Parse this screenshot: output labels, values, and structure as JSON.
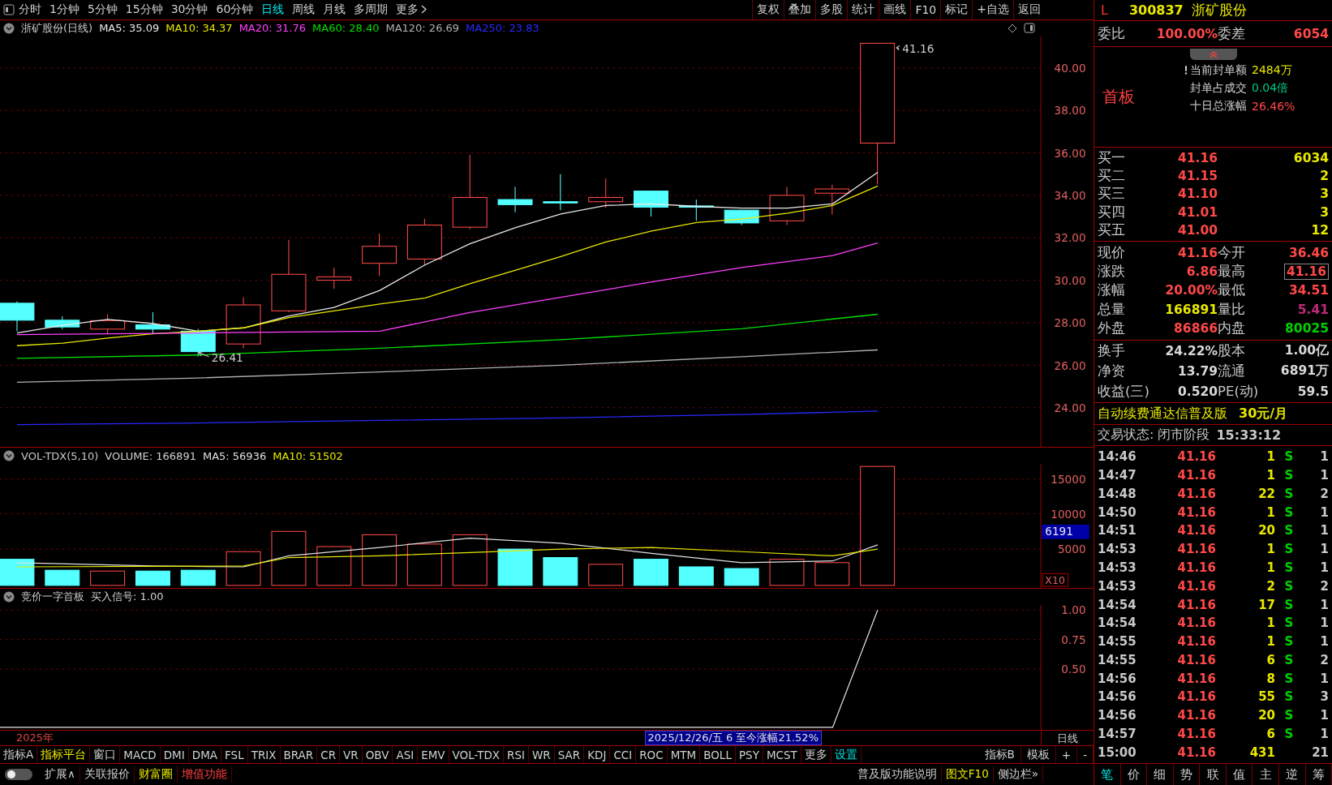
{
  "toolbar": {
    "periods": [
      {
        "label": "分时",
        "selected": false
      },
      {
        "label": "1分钟",
        "selected": false
      },
      {
        "label": "5分钟",
        "selected": false
      },
      {
        "label": "15分钟",
        "selected": false
      },
      {
        "label": "30分钟",
        "selected": false
      },
      {
        "label": "60分钟",
        "selected": false
      },
      {
        "label": "日线",
        "selected": true
      },
      {
        "label": "周线",
        "selected": false
      },
      {
        "label": "月线",
        "selected": false
      },
      {
        "label": "多周期",
        "selected": false
      }
    ],
    "more": "更多",
    "actions": [
      "复权",
      "叠加",
      "多股",
      "统计",
      "画线",
      "F10",
      "标记",
      "+自选",
      "返回"
    ]
  },
  "price_pane": {
    "title": "浙矿股份(日线)",
    "indicators": [
      {
        "label": "MA5: 35.09",
        "color": "#e8e8e8"
      },
      {
        "label": "MA10: 34.37",
        "color": "#e8e800"
      },
      {
        "label": "MA20: 31.76",
        "color": "#ff40ff"
      },
      {
        "label": "MA60: 28.40",
        "color": "#00e000"
      },
      {
        "label": "MA120: 26.69",
        "color": "#b0b0b0"
      },
      {
        "label": "MA250: 23.83",
        "color": "#2828ff"
      }
    ],
    "y_labels": [
      "40.00",
      "38.00",
      "36.00",
      "34.00",
      "32.00",
      "30.00",
      "28.00",
      "26.00",
      "24.00"
    ],
    "high_label": "41.16",
    "low_label": "26.41"
  },
  "volume_pane": {
    "title": "VOL-TDX(5,10)",
    "indicators": [
      {
        "label": "VOLUME: 166891",
        "color": "#d0d0d0"
      },
      {
        "label": "MA5: 56936",
        "color": "#e0e0e0"
      },
      {
        "label": "MA10: 51502",
        "color": "#e8e800"
      }
    ],
    "y_labels": [
      "15000",
      "10000",
      "5000"
    ],
    "cursor_value": "6191",
    "scale": "X10"
  },
  "signal_pane": {
    "title": "竞价一字首板",
    "indicators": [
      {
        "label": "买入信号: 1.00",
        "color": "#d0d0d0"
      }
    ],
    "y_labels": [
      "1.00",
      "0.75",
      "0.50"
    ]
  },
  "date_bar": {
    "year": "2025年",
    "info": "2025/12/26/五 6 至今涨幅21.52%",
    "period": "日线"
  },
  "indicator_tabs": [
    {
      "label": "指标A",
      "color": "#d0d0d0"
    },
    {
      "label": "指标平台",
      "color": "#e8e800"
    },
    {
      "label": "窗口",
      "color": "#d0d0d0"
    },
    {
      "label": "MACD",
      "color": "#d0d0d0"
    },
    {
      "label": "DMI",
      "color": "#d0d0d0"
    },
    {
      "label": "DMA",
      "color": "#d0d0d0"
    },
    {
      "label": "FSL",
      "color": "#d0d0d0"
    },
    {
      "label": "TRIX",
      "color": "#d0d0d0"
    },
    {
      "label": "BRAR",
      "color": "#d0d0d0"
    },
    {
      "label": "CR",
      "color": "#d0d0d0"
    },
    {
      "label": "VR",
      "color": "#d0d0d0"
    },
    {
      "label": "OBV",
      "color": "#d0d0d0"
    },
    {
      "label": "ASI",
      "color": "#d0d0d0"
    },
    {
      "label": "EMV",
      "color": "#d0d0d0"
    },
    {
      "label": "VOL-TDX",
      "color": "#d0d0d0"
    },
    {
      "label": "RSI",
      "color": "#d0d0d0"
    },
    {
      "label": "WR",
      "color": "#d0d0d0"
    },
    {
      "label": "SAR",
      "color": "#d0d0d0"
    },
    {
      "label": "KDJ",
      "color": "#d0d0d0"
    },
    {
      "label": "CCI",
      "color": "#d0d0d0"
    },
    {
      "label": "ROC",
      "color": "#d0d0d0"
    },
    {
      "label": "MTM",
      "color": "#d0d0d0"
    },
    {
      "label": "BOLL",
      "color": "#d0d0d0"
    },
    {
      "label": "PSY",
      "color": "#d0d0d0"
    },
    {
      "label": "MCST",
      "color": "#d0d0d0"
    },
    {
      "label": "更多",
      "color": "#d0d0d0"
    },
    {
      "label": "设置",
      "color": "#00e0e0"
    }
  ],
  "side_tabs": [
    "指标B",
    "模板",
    "+",
    "-"
  ],
  "bottom_bar": {
    "toggle": {
      "on": false
    },
    "left": [
      {
        "label": "扩展∧",
        "color": "#d0d0d0"
      },
      {
        "label": "关联报价",
        "color": "#d0d0d0"
      },
      {
        "label": "财富圈",
        "color": "#e8e800"
      },
      {
        "label": "增值功能",
        "color": "#ff4040"
      }
    ],
    "right": [
      {
        "label": "普及版功能说明",
        "color": "#d0d0d0"
      },
      {
        "label": "图文F10",
        "color": "#e8e800"
      },
      {
        "label": "侧边栏»",
        "color": "#d0d0d0"
      }
    ]
  },
  "quote": {
    "market": "L",
    "code": "300837",
    "name": "浙矿股份",
    "ratio": [
      {
        "label": "委比",
        "value": "100.00%"
      },
      {
        "label": "委差",
        "value": "6054"
      }
    ],
    "limit": {
      "tag": "首板",
      "lines": [
        {
          "label": "当前封单额",
          "value": "2484万",
          "color": "#e8e800"
        },
        {
          "label": "封单占成交",
          "value": "0.04倍",
          "color": "#00c880"
        },
        {
          "label": "十日总涨幅",
          "value": "26.46%",
          "color": "#ff4848"
        }
      ]
    },
    "bids": [
      {
        "label": "买一",
        "price": "41.16",
        "volume": "6034"
      },
      {
        "label": "买二",
        "price": "41.15",
        "volume": "2"
      },
      {
        "label": "买三",
        "price": "41.10",
        "volume": "3"
      },
      {
        "label": "买四",
        "price": "41.01",
        "volume": "3"
      },
      {
        "label": "买五",
        "price": "41.00",
        "volume": "12"
      }
    ],
    "stats": [
      [
        {
          "label": "现价",
          "value": "41.16",
          "color": "#ff4848",
          "boxed": false
        },
        {
          "label": "今开",
          "value": "36.46",
          "color": "#ff4848",
          "boxed": false
        }
      ],
      [
        {
          "label": "涨跌",
          "value": "6.86",
          "color": "#ff4848",
          "boxed": false
        },
        {
          "label": "最高",
          "value": "41.16",
          "color": "#ff4848",
          "boxed": true
        }
      ],
      [
        {
          "label": "涨幅",
          "value": "20.00%",
          "color": "#ff4848",
          "boxed": false
        },
        {
          "label": "最低",
          "value": "34.51",
          "color": "#ff4848",
          "boxed": false
        }
      ],
      [
        {
          "label": "总量",
          "value": "166891",
          "color": "#e8e800",
          "boxed": false
        },
        {
          "label": "量比",
          "value": "5.41",
          "color": "#c02878",
          "boxed": false
        }
      ],
      [
        {
          "label": "外盘",
          "value": "86866",
          "color": "#ff4848",
          "boxed": false
        },
        {
          "label": "内盘",
          "value": "80025",
          "color": "#00d000",
          "boxed": false
        }
      ]
    ],
    "fundamentals": [
      [
        {
          "label": "换手",
          "value": "24.22%"
        },
        {
          "label": "股本",
          "value": "1.00亿"
        }
      ],
      [
        {
          "label": "净资",
          "value": "13.79"
        },
        {
          "label": "流通",
          "value": "6891万"
        }
      ],
      [
        {
          "label": "收益(三)",
          "value": "0.520"
        },
        {
          "label": "PE(动)",
          "value": "59.5"
        }
      ]
    ],
    "promo": {
      "text": "自动续费通达信普及版",
      "price": "30元/月"
    },
    "status": {
      "text": "交易状态: 闭市阶段",
      "time": "15:33:12"
    },
    "trades": [
      {
        "time": "14:46",
        "price": "41.16",
        "volume": "1",
        "side": "S",
        "count": "1"
      },
      {
        "time": "14:47",
        "price": "41.16",
        "volume": "1",
        "side": "S",
        "count": "1"
      },
      {
        "time": "14:48",
        "price": "41.16",
        "volume": "22",
        "side": "S",
        "count": "2"
      },
      {
        "time": "14:50",
        "price": "41.16",
        "volume": "1",
        "side": "S",
        "count": "1"
      },
      {
        "time": "14:51",
        "price": "41.16",
        "volume": "20",
        "side": "S",
        "count": "1"
      },
      {
        "time": "14:53",
        "price": "41.16",
        "volume": "1",
        "side": "S",
        "count": "1"
      },
      {
        "time": "14:53",
        "price": "41.16",
        "volume": "1",
        "side": "S",
        "count": "1"
      },
      {
        "time": "14:53",
        "price": "41.16",
        "volume": "2",
        "side": "S",
        "count": "2"
      },
      {
        "time": "14:54",
        "price": "41.16",
        "volume": "17",
        "side": "S",
        "count": "1"
      },
      {
        "time": "14:54",
        "price": "41.16",
        "volume": "1",
        "side": "S",
        "count": "1"
      },
      {
        "time": "14:55",
        "price": "41.16",
        "volume": "1",
        "side": "S",
        "count": "1"
      },
      {
        "time": "14:55",
        "price": "41.16",
        "volume": "6",
        "side": "S",
        "count": "2"
      },
      {
        "time": "14:56",
        "price": "41.16",
        "volume": "8",
        "side": "S",
        "count": "1"
      },
      {
        "time": "14:56",
        "price": "41.16",
        "volume": "55",
        "side": "S",
        "count": "3"
      },
      {
        "time": "14:56",
        "price": "41.16",
        "volume": "20",
        "side": "S",
        "count": "1"
      },
      {
        "time": "14:57",
        "price": "41.16",
        "volume": "6",
        "side": "S",
        "count": "1"
      },
      {
        "time": "15:00",
        "price": "41.16",
        "volume": "431",
        "count": "21"
      }
    ],
    "tabs": [
      {
        "label": "笔",
        "selected": true
      },
      {
        "label": "价",
        "selected": false
      },
      {
        "label": "细",
        "selected": false
      },
      {
        "label": "势",
        "selected": false
      },
      {
        "label": "联",
        "selected": false
      },
      {
        "label": "值",
        "selected": false
      },
      {
        "label": "主",
        "selected": false
      },
      {
        "label": "逆",
        "selected": false
      },
      {
        "label": "筹",
        "selected": false
      }
    ]
  }
}
